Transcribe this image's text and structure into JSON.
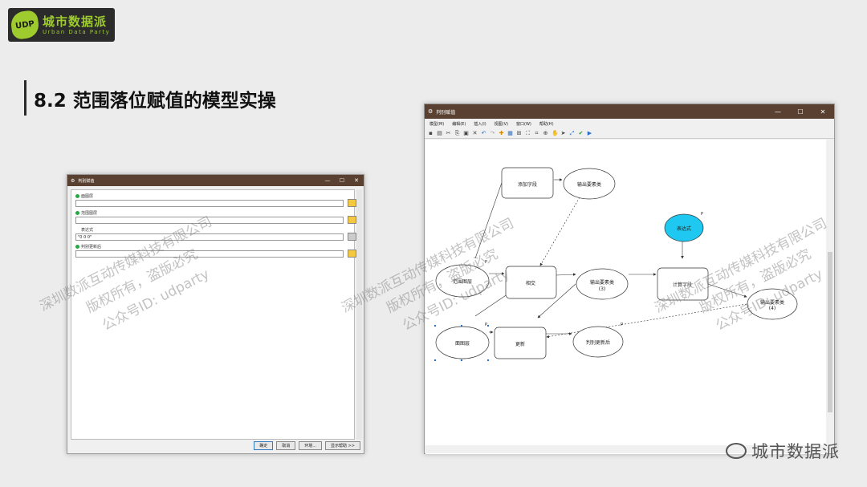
{
  "logo": {
    "badge": "UDP",
    "cn": "城市数据派",
    "en": "Urban Data Party"
  },
  "slide": {
    "title": "8.2 范围落位赋值的模型实操"
  },
  "dialog": {
    "title": "判别赋值",
    "params": [
      {
        "label": "面图层",
        "value": ""
      },
      {
        "label": "范围图层",
        "value": ""
      },
      {
        "label": "表达式",
        "value": "\"0 0 0\""
      },
      {
        "label": "判别更新后",
        "value": ""
      }
    ],
    "buttons": {
      "ok": "确定",
      "cancel": "取消",
      "env": "环境...",
      "help": "显示帮助 >>"
    }
  },
  "model_builder": {
    "title": "判别赋值",
    "menu": [
      "模型(M)",
      "编辑(E)",
      "插入(I)",
      "视图(V)",
      "窗口(W)",
      "帮助(H)"
    ],
    "nodes": {
      "add_field": "添加字段",
      "output1": "输出要素类",
      "intersect": "相交",
      "output3_line1": "输出要素类",
      "output3_line2": "(3)",
      "expression": "表达式",
      "calc_field": "计算字段",
      "output4_line1": "输出要素类",
      "output4_line2": "(4)",
      "range_layer": "范围图层",
      "face_layer": "面图层",
      "update": "更新",
      "result": "判别更新后",
      "p": "P"
    }
  },
  "watermark": {
    "line1": "深圳数派互动传媒科技有限公司",
    "line2": "版权所有，盗版必究",
    "line3": "公众号ID: udparty"
  },
  "brand": {
    "text": "城市数据派"
  }
}
